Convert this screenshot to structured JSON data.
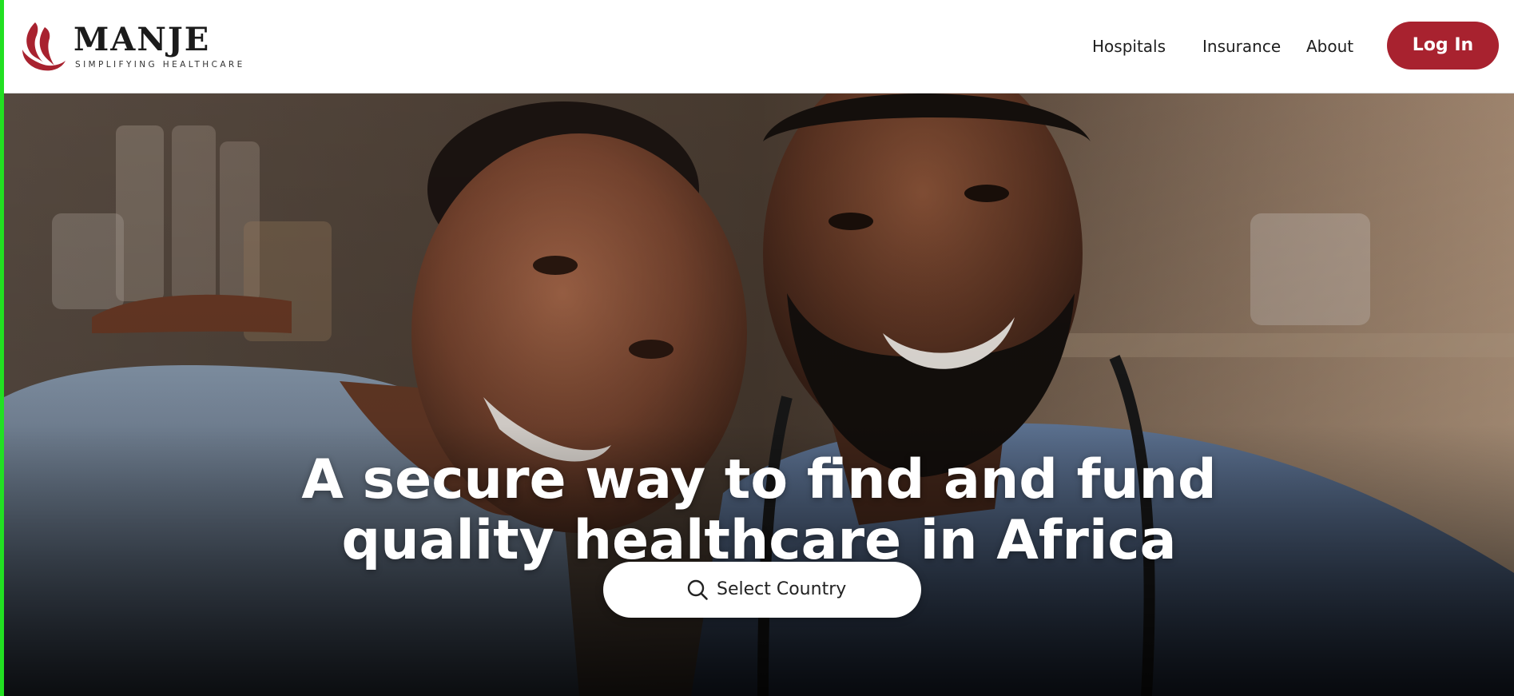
{
  "brand": {
    "name": "MANJE",
    "tagline": "SIMPLIFYING HEALTHCARE",
    "color": "#a8222f"
  },
  "nav": {
    "items": [
      {
        "label": "Hospitals"
      },
      {
        "label": "Insurance"
      },
      {
        "label": "About"
      }
    ],
    "login_label": "Log In"
  },
  "hero": {
    "title_line1": "A secure way to find and fund",
    "title_line2": "quality healthcare in Africa",
    "country_button_label": "Select Country",
    "country_button_icon": "search-icon"
  }
}
